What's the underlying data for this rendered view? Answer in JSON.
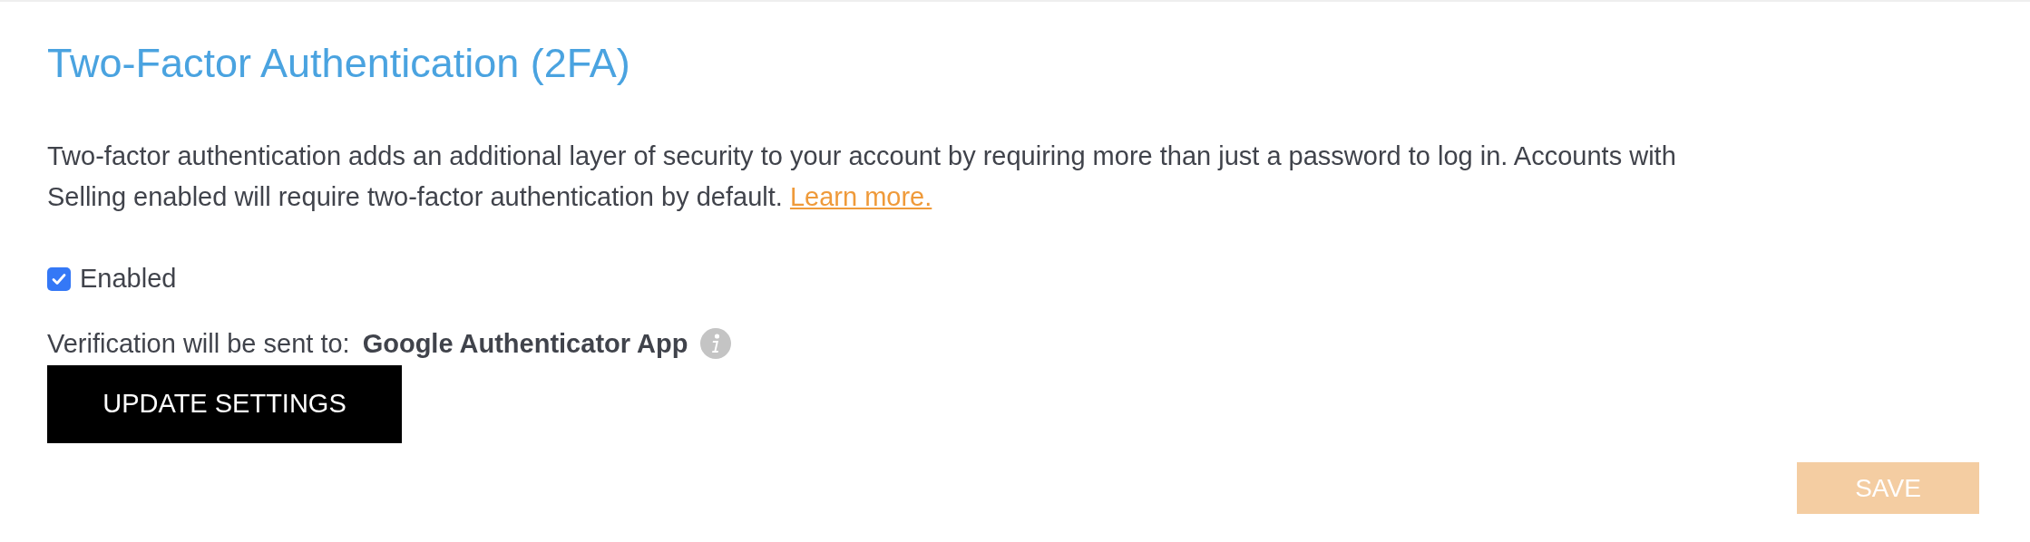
{
  "title": "Two-Factor Authentication (2FA)",
  "description": "Two-factor authentication adds an additional layer of security to your account by requiring more than just a password to log in. Accounts with Selling enabled will require two-factor authentication by default.",
  "learn_more_link": "Learn more.",
  "enabled_checkbox": {
    "label": "Enabled",
    "checked": true
  },
  "verification": {
    "label": "Verification will be sent to:",
    "value": "Google Authenticator App"
  },
  "update_button": "UPDATE SETTINGS",
  "save_button": {
    "label": "SAVE",
    "disabled": true
  }
}
